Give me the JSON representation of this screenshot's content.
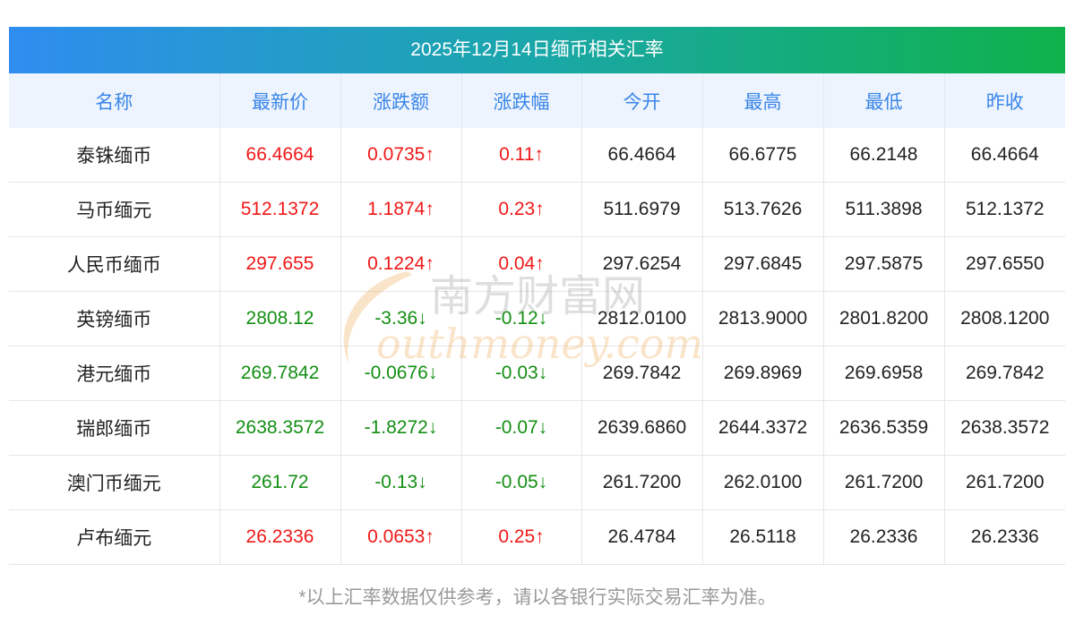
{
  "title": "2025年12月14日缅币相关汇率",
  "colors": {
    "up": "#f01818",
    "down": "#138f13",
    "header_text": "#3a86e8"
  },
  "headers": [
    "名称",
    "最新价",
    "涨跌额",
    "涨跌幅",
    "今开",
    "最高",
    "最低",
    "昨收"
  ],
  "rows": [
    {
      "name": "泰铢缅币",
      "latest": "66.4664",
      "change": "0.0735↑",
      "pct": "0.11↑",
      "open": "66.4664",
      "high": "66.6775",
      "low": "66.2148",
      "prev": "66.4664",
      "dir": "up"
    },
    {
      "name": "马币缅元",
      "latest": "512.1372",
      "change": "1.1874↑",
      "pct": "0.23↑",
      "open": "511.6979",
      "high": "513.7626",
      "low": "511.3898",
      "prev": "512.1372",
      "dir": "up"
    },
    {
      "name": "人民币缅币",
      "latest": "297.655",
      "change": "0.1224↑",
      "pct": "0.04↑",
      "open": "297.6254",
      "high": "297.6845",
      "low": "297.5875",
      "prev": "297.6550",
      "dir": "up"
    },
    {
      "name": "英镑缅币",
      "latest": "2808.12",
      "change": "-3.36↓",
      "pct": "-0.12↓",
      "open": "2812.0100",
      "high": "2813.9000",
      "low": "2801.8200",
      "prev": "2808.1200",
      "dir": "down"
    },
    {
      "name": "港元缅币",
      "latest": "269.7842",
      "change": "-0.0676↓",
      "pct": "-0.03↓",
      "open": "269.7842",
      "high": "269.8969",
      "low": "269.6958",
      "prev": "269.7842",
      "dir": "down"
    },
    {
      "name": "瑞郎缅币",
      "latest": "2638.3572",
      "change": "-1.8272↓",
      "pct": "-0.07↓",
      "open": "2639.6860",
      "high": "2644.3372",
      "low": "2636.5359",
      "prev": "2638.3572",
      "dir": "down"
    },
    {
      "name": "澳门币缅元",
      "latest": "261.72",
      "change": "-0.13↓",
      "pct": "-0.05↓",
      "open": "261.7200",
      "high": "262.0100",
      "low": "261.7200",
      "prev": "261.7200",
      "dir": "down"
    },
    {
      "name": "卢布缅元",
      "latest": "26.2336",
      "change": "0.0653↑",
      "pct": "0.25↑",
      "open": "26.4784",
      "high": "26.5118",
      "low": "26.2336",
      "prev": "26.2336",
      "dir": "up"
    }
  ],
  "watermark": {
    "cn": "南方财富网",
    "en": "outhmoney.com"
  },
  "footnote": "*以上汇率数据仅供参考，请以各银行实际交易汇率为准。"
}
